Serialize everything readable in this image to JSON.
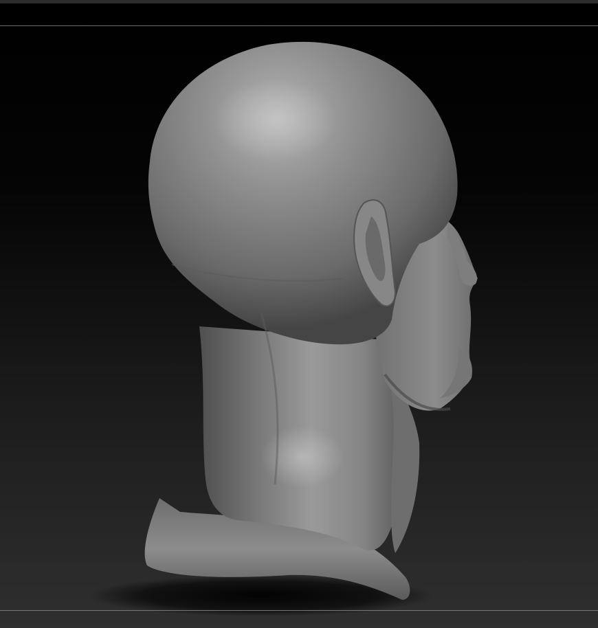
{
  "viewport": {
    "subject": "sculpt-model",
    "colors": {
      "background_top": "#000000",
      "background_bottom": "#2f2f2f",
      "material": "#8a8a8a",
      "shadow": "#0a0a0a"
    }
  }
}
